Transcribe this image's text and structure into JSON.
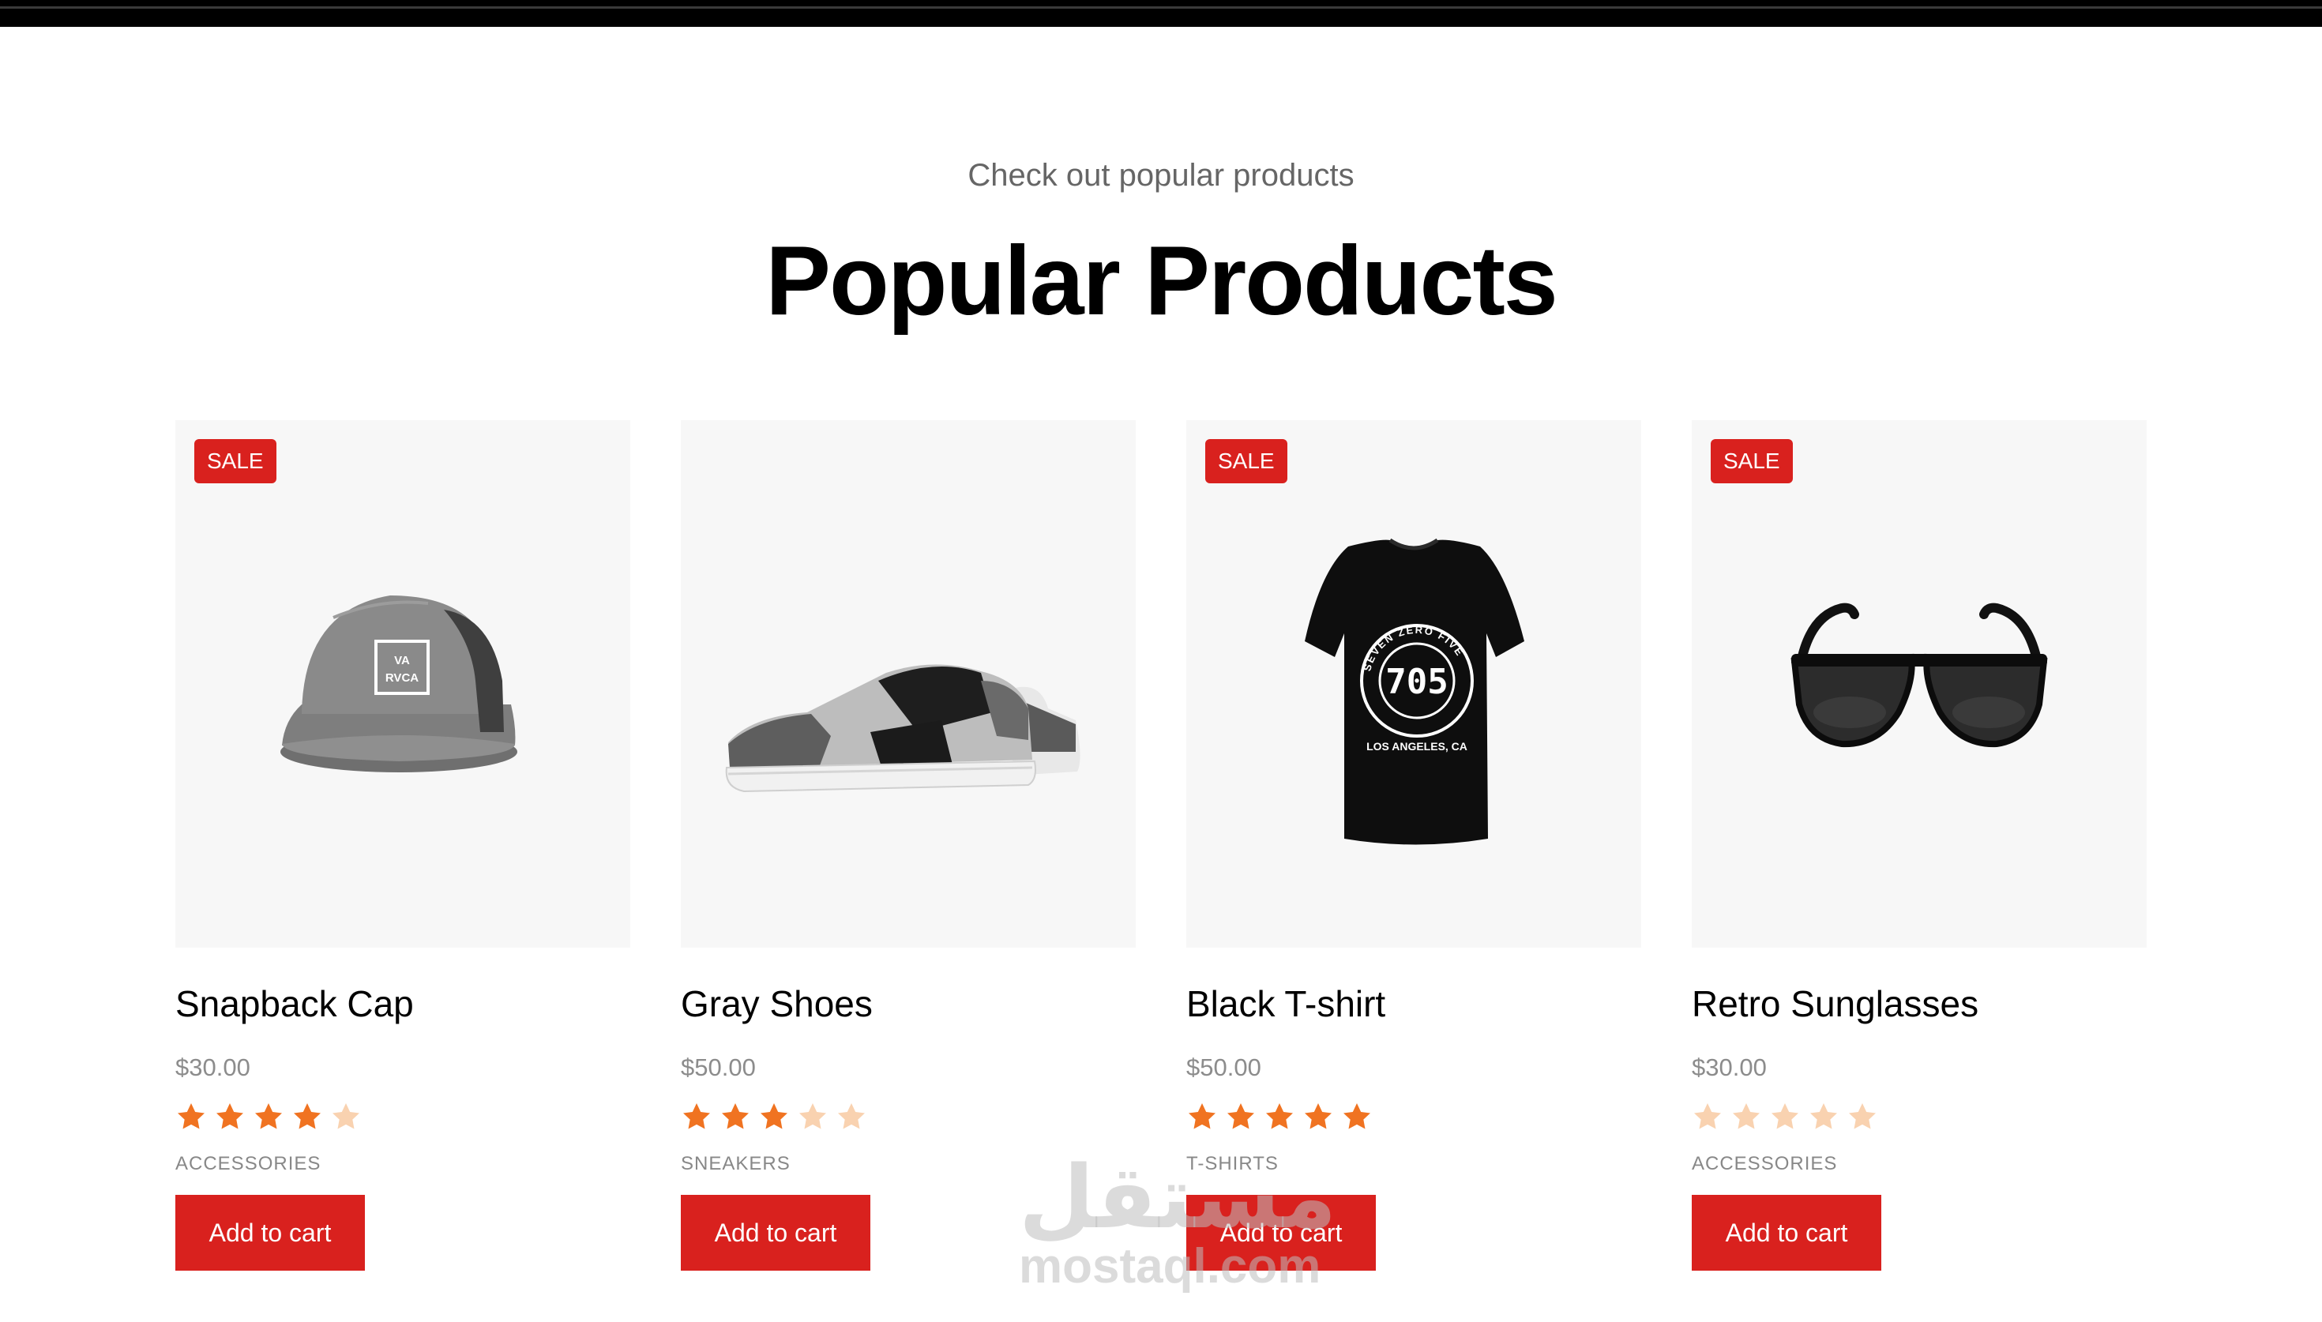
{
  "section": {
    "subtitle": "Check out popular products",
    "title": "Popular Products"
  },
  "colors": {
    "accent": "#d9211e",
    "star_filled": "#f07321",
    "star_empty": "#f9d2b0",
    "image_bg": "#f7f7f7"
  },
  "products": [
    {
      "name": "Snapback Cap",
      "price": "$30.00",
      "category": "ACCESSORIES",
      "rating": 4,
      "sale": true,
      "badge": "SALE",
      "button": "Add to cart",
      "icon": "cap-image"
    },
    {
      "name": "Gray Shoes",
      "price": "$50.00",
      "category": "SNEAKERS",
      "rating": 3,
      "sale": false,
      "badge": "",
      "button": "Add to cart",
      "icon": "shoes-image"
    },
    {
      "name": "Black T-shirt",
      "price": "$50.00",
      "category": "T-SHIRTS",
      "rating": 5,
      "sale": true,
      "badge": "SALE",
      "button": "Add to cart",
      "icon": "tshirt-image"
    },
    {
      "name": "Retro Sunglasses",
      "price": "$30.00",
      "category": "ACCESSORIES",
      "rating": 0,
      "sale": true,
      "badge": "SALE",
      "button": "Add to cart",
      "icon": "sunglasses-image"
    }
  ],
  "product_art": {
    "cap_logo_line1": "VA",
    "cap_logo_line2": "RVCA",
    "shirt_number": "705",
    "shirt_ring_text": "SEVEN ZERO FIVE",
    "shirt_city": "LOS ANGELES, CA"
  },
  "watermark": {
    "arabic": "مستقل",
    "latin": "mostaql.com"
  }
}
